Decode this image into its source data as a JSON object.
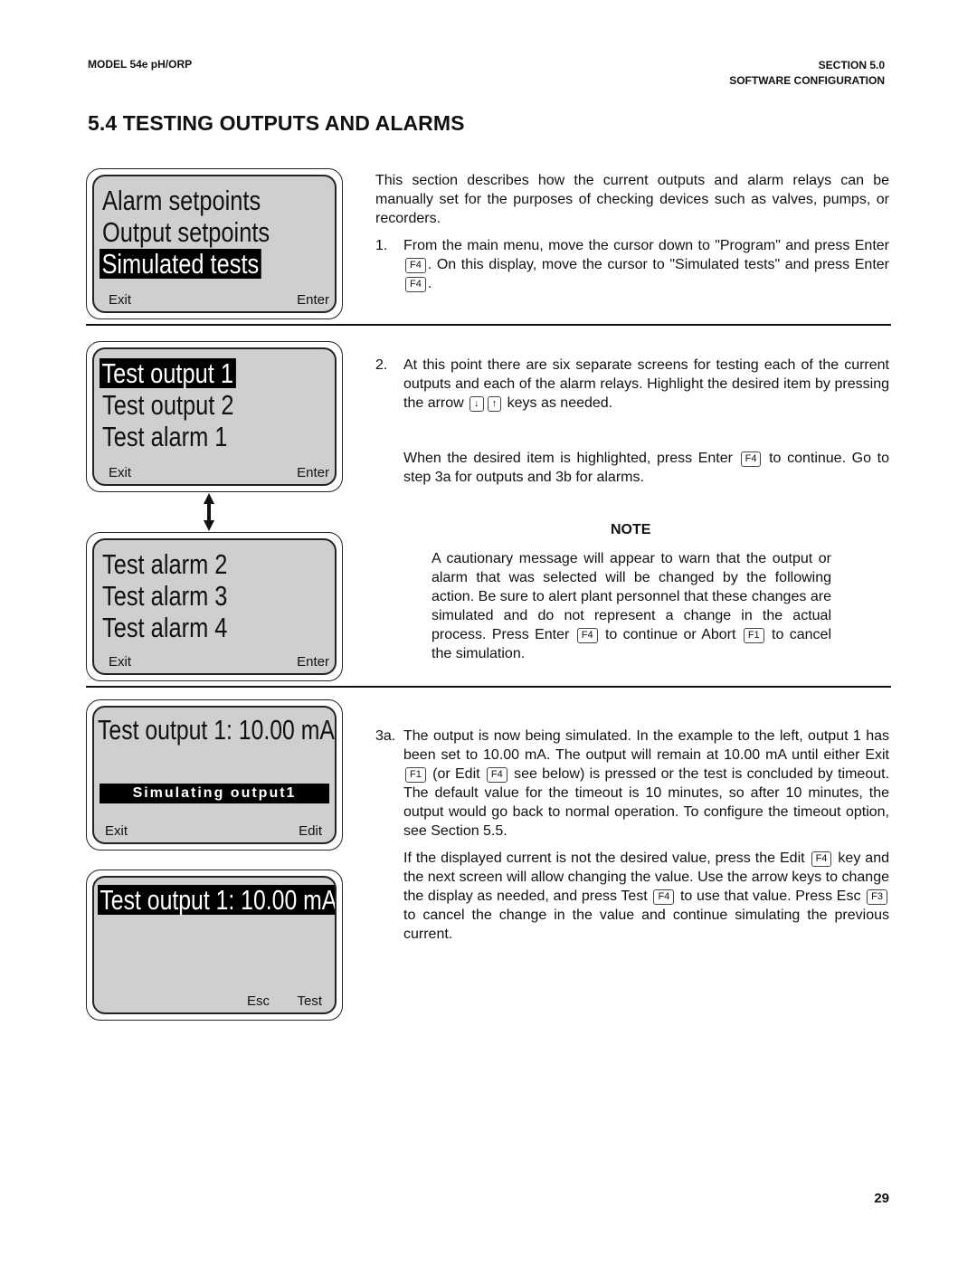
{
  "header": {
    "model": "MODEL 54e pH/ORP",
    "section": "SECTION 5.0",
    "section_name": "SOFTWARE CONFIGURATION"
  },
  "title": "5.4 TESTING OUTPUTS AND ALARMS",
  "page_number": "29",
  "screens": [
    {
      "lines": [
        "Alarm setpoints",
        "Output setpoints",
        "Simulated tests"
      ],
      "highlighted_index": 2,
      "softkeys": {
        "left": "Exit",
        "right": "Enter"
      }
    },
    {
      "lines": [
        "Test output 1",
        "Test output 2",
        "Test alarm 1"
      ],
      "highlighted_index": 0,
      "softkeys": {
        "left": "Exit",
        "right": "Enter"
      }
    },
    {
      "lines": [
        "Test alarm 2",
        "Test alarm 3",
        "Test alarm 4"
      ],
      "highlighted_index": -1,
      "softkeys": {
        "left": "Exit",
        "right": "Enter"
      }
    },
    {
      "lines": [
        "Test output 1: 10.00 mA"
      ],
      "status_bar": "Simulating output1",
      "softkeys": {
        "left": "Exit",
        "right": "Edit"
      }
    },
    {
      "lines": [
        "Test output 1: 10.00 mA"
      ],
      "highlighted_index": 0,
      "softkeys": {
        "mid": "Esc",
        "right": "Test"
      }
    }
  ],
  "arrow_icon": "up-down-arrow",
  "text": {
    "intro": "This section describes how the current outputs and alarm relays can be manually set for the purposes of checking devices such as valves, pumps, or recorders.",
    "step1": {
      "num": "1.",
      "a": "From the main menu, move the cursor down to \"Program\" and press Enter",
      "key1": "F4",
      "b": ". On this display, move the cursor to \"Simulated tests\" and press Enter",
      "key2": "F4",
      "c": "."
    },
    "step2": {
      "num": "2.",
      "a": "At this point there are six separate screens for testing each of the current outputs and each of the alarm relays.  Highlight the desired item by pressing the arrow",
      "key_down": "↓",
      "key_up": "↑",
      "b": "keys as needed."
    },
    "step2_cont": {
      "a": "When the desired item is highlighted, press Enter",
      "key": "F4",
      "b": "to continue. Go to step 3a for outputs and 3b for alarms."
    },
    "note": {
      "title": "NOTE",
      "a": "A cautionary message will appear to warn that the output or alarm that was selected will be changed by the following action.  Be sure to alert plant personnel that these changes are simulated and do not represent a change in the actual process. Press Enter",
      "key1": "F4",
      "b": "to continue or  Abort",
      "key2": "F1",
      "c": "to cancel the simulation."
    },
    "step3a": {
      "num": "3a.",
      "a": "The output is now being simulated.  In the example to the left, output 1 has been set to 10.00 mA. The output will remain at 10.00 mA until either Exit",
      "key1": "F1",
      "b": "(or Edit",
      "key2": "F4",
      "c": "see below) is pressed or the test is concluded by timeout.  The default value for the timeout is 10 minutes, so after 10 minutes, the output would go back to normal operation.  To configure the timeout option, see Section 5.5."
    },
    "step3a_cont": {
      "a": "If the displayed current is not the desired value, press the Edit",
      "key1": "F4",
      "b": "key and the next screen will allow changing the value.  Use the arrow keys to change the display as needed, and press Test",
      "key2": "F4",
      "c": "to use that value.  Press Esc",
      "key3": "F3",
      "d": "to cancel the change in the value and continue simulating the previous current."
    }
  }
}
